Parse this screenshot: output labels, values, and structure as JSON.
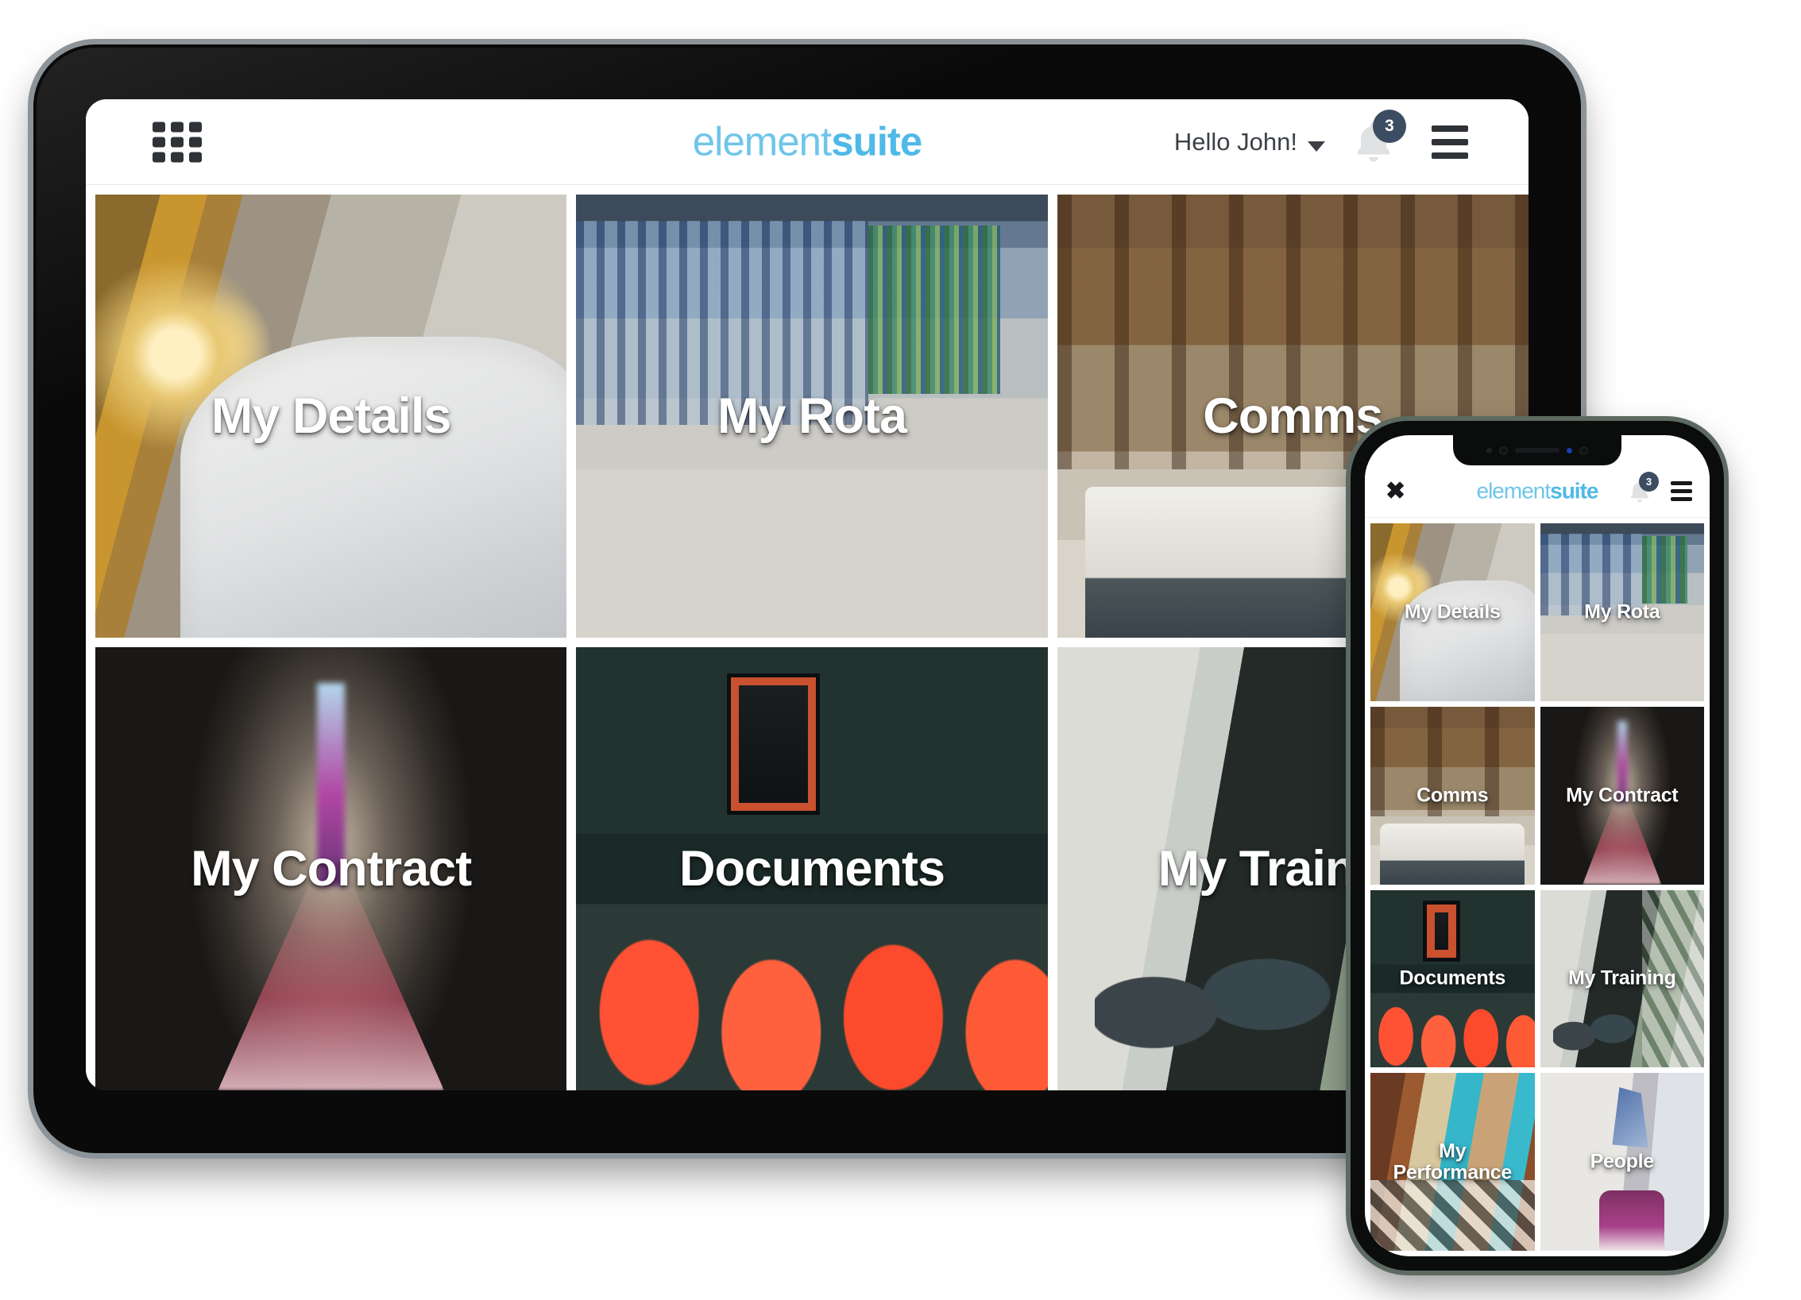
{
  "brand": {
    "part1": "element",
    "part2": "suite",
    "color_light": "#6fc5ea",
    "color_bold": "#4fb9e8"
  },
  "tablet": {
    "header": {
      "grid_icon": "apps-grid-icon",
      "greeting": "Hello John!",
      "caret": "chevron-down-icon",
      "bell_icon": "bell-icon",
      "notification_count": "3",
      "badge_color": "#3c4d63",
      "menu_icon": "hamburger-menu-icon"
    },
    "tiles": [
      {
        "label": "My Details",
        "photo": "ph-bed"
      },
      {
        "label": "My Rota",
        "photo": "ph-lobby"
      },
      {
        "label": "Comms",
        "photo": "ph-atrium"
      },
      {
        "label": "My Contract",
        "photo": "ph-corridor"
      },
      {
        "label": "Documents",
        "photo": "ph-restaurant"
      },
      {
        "label": "My Training",
        "photo": "ph-lounge"
      }
    ]
  },
  "phone": {
    "header": {
      "close_icon": "close-icon",
      "bell_icon": "bell-icon",
      "notification_count": "3",
      "menu_icon": "hamburger-menu-icon"
    },
    "tiles": [
      {
        "label": "My Details",
        "photo": "ph-bed"
      },
      {
        "label": "My Rota",
        "photo": "ph-lobby"
      },
      {
        "label": "Comms",
        "photo": "ph-atrium"
      },
      {
        "label": "My Contract",
        "photo": "ph-corridor"
      },
      {
        "label": "Documents",
        "photo": "ph-restaurant"
      },
      {
        "label": "My Training",
        "photo": "ph-lounge"
      },
      {
        "label": "My Performance",
        "photo": "ph-brasserie"
      },
      {
        "label": "People",
        "photo": "ph-bedroom2"
      }
    ]
  }
}
